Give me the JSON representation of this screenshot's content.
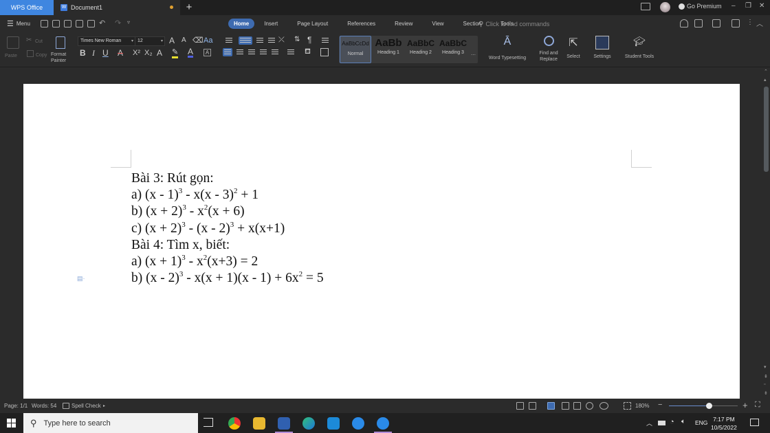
{
  "titlebar": {
    "app_tab": "WPS Office",
    "doc_tab": "Document1",
    "doc_icon": "W",
    "new_tab": "+",
    "premium": "Go Premium",
    "minimize": "–",
    "restore": "❐",
    "close": "✕"
  },
  "menubar": {
    "menu_label": "Menu",
    "tabs": [
      "Home",
      "Insert",
      "Page Layout",
      "References",
      "Review",
      "View",
      "Section",
      "Tools"
    ],
    "active_tab": "Home",
    "search_placeholder": "Click to find commands"
  },
  "ribbon": {
    "clipboard": {
      "paste": "Paste",
      "cut": "Cut",
      "copy": "Copy",
      "format_painter_1": "Format",
      "format_painter_2": "Painter"
    },
    "font": {
      "family": "Times New Roman",
      "size": "12",
      "grow": "A",
      "shrink": "A",
      "case": "Aa",
      "bold": "B",
      "italic": "I",
      "underline": "U",
      "strikethrough": "A",
      "superscript": "X²",
      "subscript": "X₂",
      "effects": "A",
      "font_color": "A",
      "char_shading": "A"
    },
    "styles": [
      {
        "preview": "AaBbCcDd",
        "name": "Normal",
        "active": true
      },
      {
        "preview": "AaBb",
        "name": "Heading 1",
        "active": false
      },
      {
        "preview": "AaBbC",
        "name": "Heading 2",
        "active": false
      },
      {
        "preview": "AaBbC",
        "name": "Heading 3",
        "active": false
      }
    ],
    "tools": {
      "word_typesetting": "Word Typesetting",
      "find_replace_1": "Find and",
      "find_replace_2": "Replace",
      "select": "Select",
      "settings": "Settings",
      "student_tools": "Student Tools"
    }
  },
  "document": {
    "lines": [
      {
        "parts": [
          {
            "t": "Bài 3: Rút gọn:"
          }
        ]
      },
      {
        "parts": [
          {
            "t": "a) (x - 1)"
          },
          {
            "sup": "3"
          },
          {
            "t": " - x(x - 3)"
          },
          {
            "sup": "2"
          },
          {
            "t": " + 1"
          }
        ]
      },
      {
        "parts": [
          {
            "t": "b) (x + 2)"
          },
          {
            "sup": "3"
          },
          {
            "t": " - x"
          },
          {
            "sup": "2"
          },
          {
            "t": "(x + 6)"
          }
        ]
      },
      {
        "parts": [
          {
            "t": "c) (x + 2)"
          },
          {
            "sup": "3"
          },
          {
            "t": " - (x - 2)"
          },
          {
            "sup": "3"
          },
          {
            "t": " + x(x+1)"
          }
        ]
      },
      {
        "parts": [
          {
            "t": "Bài 4: Tìm x, biết:"
          }
        ]
      },
      {
        "parts": [
          {
            "t": "a) (x + 1)"
          },
          {
            "sup": "3"
          },
          {
            "t": " - x"
          },
          {
            "sup": "2"
          },
          {
            "t": "(x+3) = 2"
          }
        ]
      },
      {
        "parts": [
          {
            "t": "b) (x - 2)"
          },
          {
            "sup": "3"
          },
          {
            "t": " - x(x + 1)(x - 1) + 6x"
          },
          {
            "sup": "2"
          },
          {
            "t": " = 5"
          }
        ]
      }
    ]
  },
  "statusbar": {
    "page": "Page: 1/1",
    "words": "Words: 54",
    "spell_check": "Spell Check",
    "zoom_level": "180%",
    "zoom_fraction": 0.58
  },
  "taskbar": {
    "search_placeholder": "Type here to search",
    "apps": [
      "task-view",
      "chrome",
      "file-explorer",
      "wps-office",
      "edge",
      "mail",
      "zalo",
      "zalo"
    ],
    "language": "ENG",
    "time": "7:17 PM",
    "date": "10/5/2022"
  }
}
